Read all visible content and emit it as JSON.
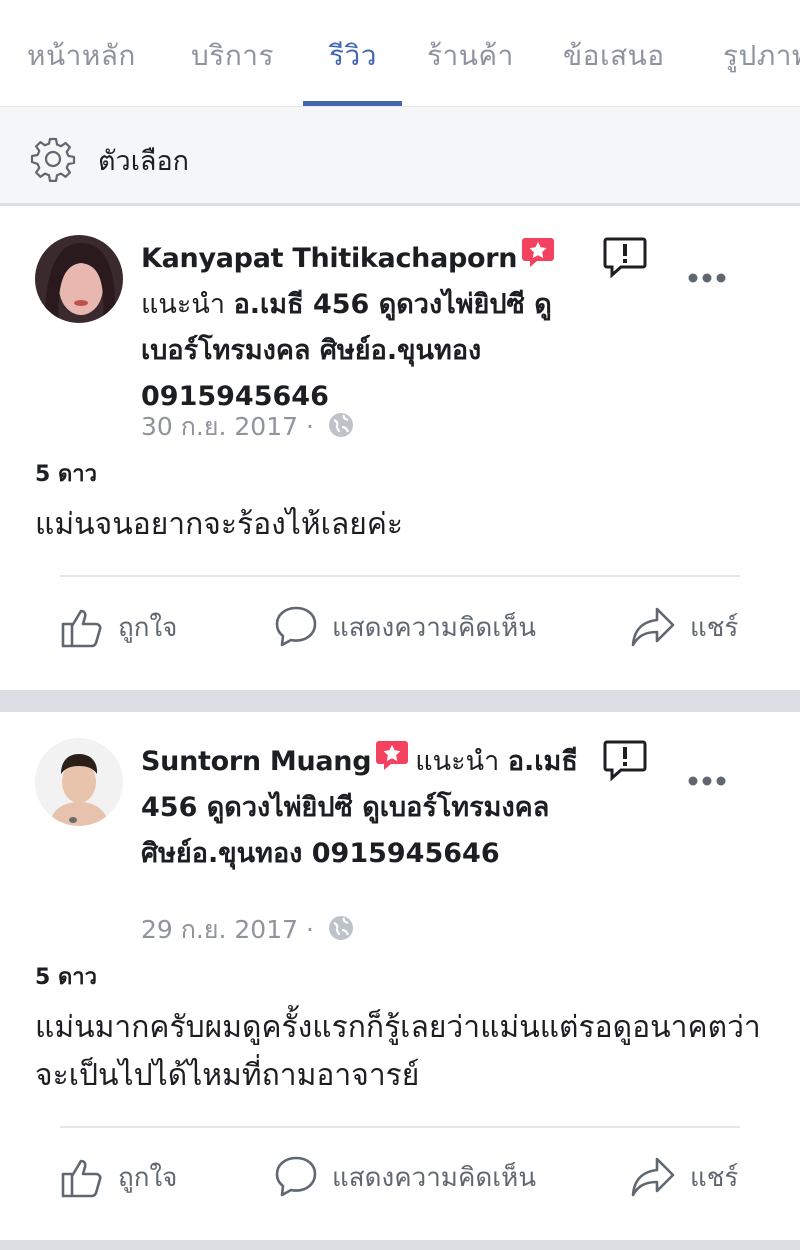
{
  "tabs": [
    {
      "label": "หน้าหลัก",
      "active": false
    },
    {
      "label": "บริการ",
      "active": false
    },
    {
      "label": "รีวิว",
      "active": true
    },
    {
      "label": "ร้านค้า",
      "active": false
    },
    {
      "label": "ข้อเสนอ",
      "active": false
    },
    {
      "label": "รูปภาพ",
      "active": false
    }
  ],
  "options": {
    "label": "ตัวเลือก",
    "icon": "gear-icon"
  },
  "reviews": [
    {
      "author": "Kanyapat Thitikachaporn",
      "recommend": "แนะนำ",
      "page_name": "อ.เมธี 456 ดูดวงไพ่ยิปซี ดูเบอร์โทรมงคล ศิษย์อ.ขุนทอง 0915945646",
      "date": "30 ก.ย. 2017",
      "separator": "·",
      "rating": "5 ดาว",
      "text": "แม่นจนอยากจะร้องไห้เลยค่ะ"
    },
    {
      "author": "Suntorn Muang",
      "recommend": "แนะนำ",
      "page_name": "อ.เมธี 456 ดูดวงไพ่ยิปซี ดูเบอร์โทรมงคล ศิษย์อ.ขุนทอง 0915945646",
      "date": "29 ก.ย. 2017",
      "separator": "·",
      "rating": "5 ดาว",
      "text": "แม่นมากครับผมดูครั้งแรกก็รู้เลยว่าแม่นแต่รอดูอนาคตว่าจะเป็นไปได้ไหมที่ถามอาจารย์"
    }
  ],
  "actions": {
    "like": "ถูกใจ",
    "comment": "แสดงความคิดเห็น",
    "share": "แชร์"
  },
  "colors": {
    "accent": "#4267b2",
    "badge": "#f3425f",
    "muted": "#90949c",
    "gap": "#dadde1"
  }
}
